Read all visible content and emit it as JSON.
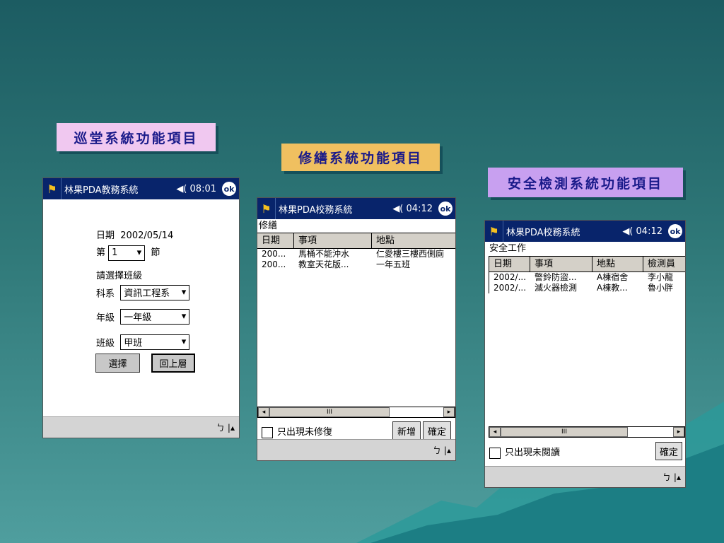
{
  "labels": [
    "巡堂系統功能項目",
    "修繕系統功能項目",
    "安全檢測系統功能項目"
  ],
  "colors": {
    "label1": "#f0c8f0",
    "label2": "#f0c060",
    "label3": "#c8a0f0",
    "titlebar": "#08246b"
  },
  "pda1": {
    "title": "林果PDA教務系統",
    "time": "08:01",
    "ok": "ok",
    "date_label": "日期",
    "date": "2002/05/14",
    "period_prefix": "第",
    "period": "1",
    "period_suffix": "節",
    "prompt": "請選擇班級",
    "dept_label": "科系",
    "dept": "資訊工程系",
    "grade_label": "年級",
    "grade": "一年級",
    "class_label": "班級",
    "class": "甲班",
    "select_btn": "選擇",
    "back_btn": "回上層"
  },
  "pda2": {
    "title": "林果PDA校務系統",
    "time": "04:12",
    "ok": "ok",
    "section": "修繕",
    "columns": [
      "日期",
      "事項",
      "地點"
    ],
    "rows": [
      [
        "200...",
        "馬桶不能沖水",
        "仁愛樓三樓西側廁"
      ],
      [
        "200...",
        "教室天花版...",
        "一年五班"
      ]
    ],
    "checkbox": "只出現未修復",
    "add_btn": "新增",
    "confirm_btn": "確定",
    "scroll_mid": "III"
  },
  "pda3": {
    "title": "林果PDA校務系統",
    "time": "04:12",
    "ok": "ok",
    "section": "安全工作",
    "columns": [
      "日期",
      "事項",
      "地點",
      "檢測員"
    ],
    "rows": [
      [
        "2002/...",
        "警鈴防盜...",
        "A棟宿舍",
        "李小龍"
      ],
      [
        "2002/...",
        "滅火器檢測",
        "A棟教...",
        "魯小胖"
      ]
    ],
    "checkbox": "只出現未閱讀",
    "confirm_btn": "確定",
    "scroll_mid": "III"
  },
  "bottom_icons": "ㄅ"
}
